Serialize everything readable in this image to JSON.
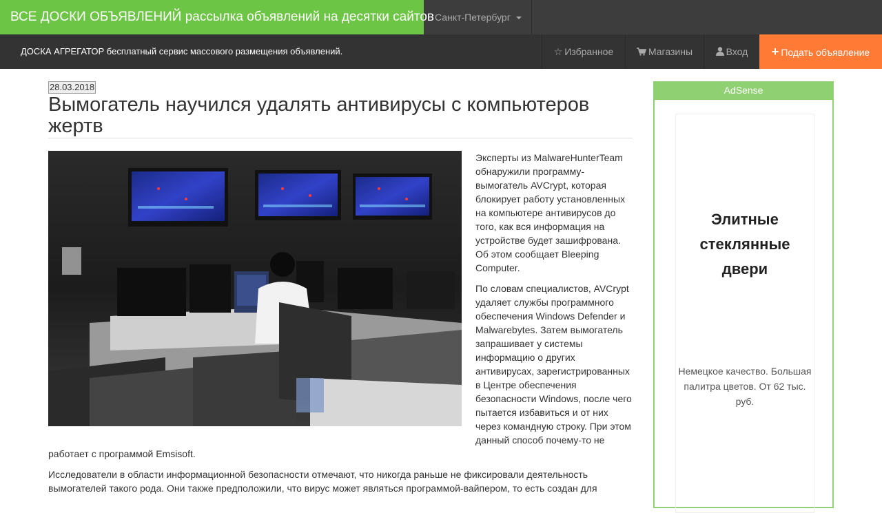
{
  "header": {
    "brand": "ВСЕ ДОСКИ ОБЪЯВЛЕНИЙ рассылка объявлений на десятки сайтов",
    "city": "Санкт-Петербург"
  },
  "navbar": {
    "tagline": "ДОСКА АГРЕГАТОР бесплатный сервис массового размещения объявлений.",
    "favorites_label": "Избранное",
    "favorites_icon": "star-icon",
    "shops_label": "Магазины",
    "shops_icon": "cart-icon",
    "login_label": "Вход",
    "login_icon": "user-icon",
    "post_label": "Подать объявление",
    "post_icon": "plus-icon",
    "accent_color": "#ff7a35",
    "brand_color": "#6dc545"
  },
  "article": {
    "date": "28.03.2018",
    "title": "Вымогатель научился удалять антивирусы с компьютеров жертв",
    "paragraphs": [
      "Эксперты из MalwareHunterTeam обнаружили программу-вымогатель AVCrypt, которая блокирует работу установленных на компьютере антивирусов до того, как вся информация на устройстве будет зашифрована. Об этом сообщает Bleeping Computer.",
      "По словам специалистов, AVCrypt удаляет службы программного обеспечения Windows Defender и Malwarebytes. Затем вымогатель запрашивает у системы информацию о других антивирусах, зарегистрированных в Центре обеспечения безопасности Windows, после чего пытается избавиться и от них через командную строку. При этом данный способ почему-то не",
      "работает с программой Emsisoft.",
      "Исследователи в области информационной безопасности отмечают, что никогда раньше не фиксировали деятельность вымогателей такого рода. Они также предположили, что вирус может являться программой-вайпером, то есть создан для"
    ]
  },
  "sidebar": {
    "ad_header": "AdSense",
    "ad_title": "Элитные стеклянные двери",
    "ad_text": "Немецкое качество. Большая палитра цветов. От 62 тыс. руб."
  }
}
